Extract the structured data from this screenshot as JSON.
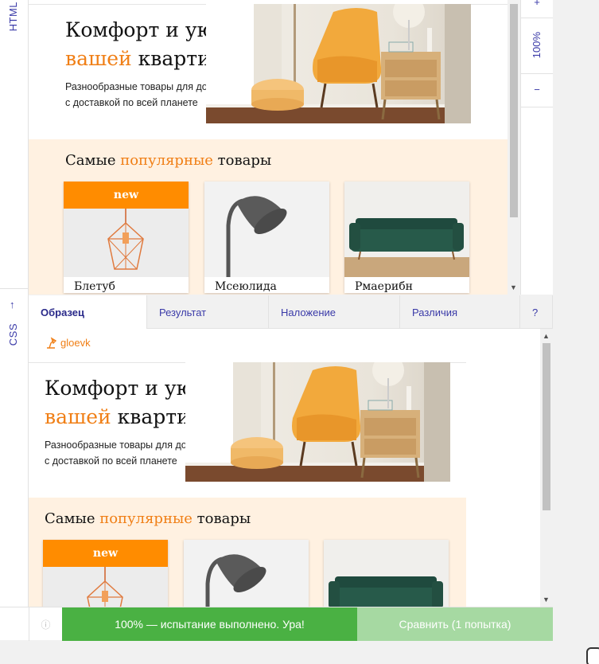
{
  "rail": {
    "top_label": "HTML",
    "bottom_label": "CSS",
    "arrow": "↑"
  },
  "zoom": {
    "plus": "+",
    "value": "100%",
    "minus": "−"
  },
  "tabs": [
    {
      "label": "Образец"
    },
    {
      "label": "Результат"
    },
    {
      "label": "Наложение"
    },
    {
      "label": "Различия"
    },
    {
      "label": "?"
    }
  ],
  "logo": {
    "text": "gloevk",
    "icon": "lamp-icon"
  },
  "hero": {
    "title_line1": "Комфорт и уют в",
    "title_accent": "вашей",
    "title_rest": " квартире",
    "sub_line1": "Разнообразные товары для дома",
    "sub_line2": "с доставкой по всей планете"
  },
  "popular": {
    "title_before": "Самые ",
    "title_accent": "популярные",
    "title_after": " товары",
    "products": [
      {
        "name": "Блетуб",
        "badge": "new",
        "icon": "pendant-lamp-icon"
      },
      {
        "name": "Мсеюлида",
        "badge": "",
        "icon": "floor-lamp-icon"
      },
      {
        "name": "Рмаерибн",
        "badge": "",
        "icon": "sofa-icon"
      }
    ]
  },
  "status": {
    "info_icon": "ⓘ",
    "result_text": "100% — испытание выполнено. Ура!",
    "compare_text": "Сравнить (1 попытка)"
  },
  "colors": {
    "accent": "#f07f16",
    "badge": "#ff8c00",
    "success": "#4ab143",
    "section_bg": "#fff1e1",
    "ui": "#3a3aa8"
  }
}
